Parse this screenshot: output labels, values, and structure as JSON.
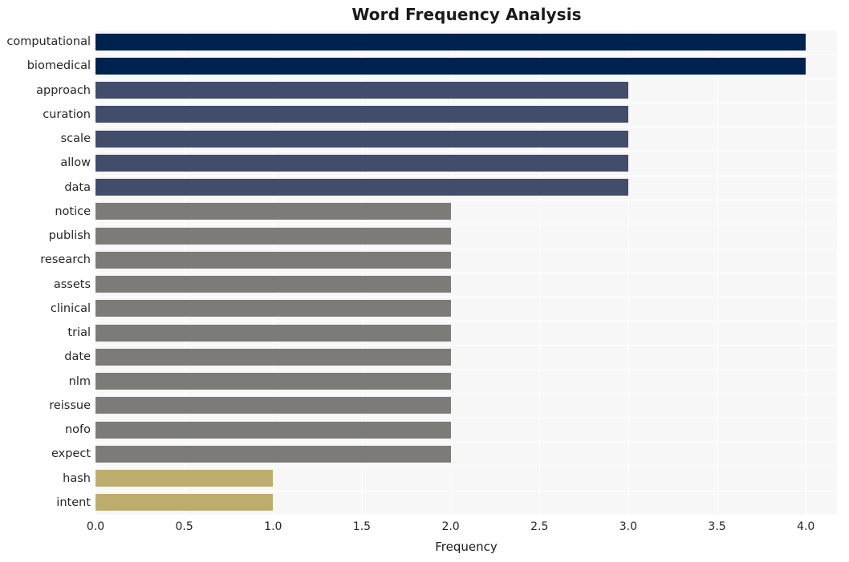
{
  "chart_data": {
    "type": "bar",
    "orientation": "horizontal",
    "title": "Word Frequency Analysis",
    "xlabel": "Frequency",
    "ylabel": "",
    "xlim": [
      0,
      4.0
    ],
    "xticks": [
      "0.0",
      "0.5",
      "1.0",
      "1.5",
      "2.0",
      "2.5",
      "3.0",
      "3.5",
      "4.0"
    ],
    "xtick_values": [
      0.0,
      0.5,
      1.0,
      1.5,
      2.0,
      2.5,
      3.0,
      3.5,
      4.0
    ],
    "grid": true,
    "legend": null,
    "plot_background": "#f7f7f7",
    "grid_color": "#ffffff",
    "categories": [
      "computational",
      "biomedical",
      "approach",
      "curation",
      "scale",
      "allow",
      "data",
      "notice",
      "publish",
      "research",
      "assets",
      "clinical",
      "trial",
      "date",
      "nlm",
      "reissue",
      "nofo",
      "expect",
      "hash",
      "intent"
    ],
    "values": [
      4,
      4,
      3,
      3,
      3,
      3,
      3,
      2,
      2,
      2,
      2,
      2,
      2,
      2,
      2,
      2,
      2,
      2,
      1,
      1
    ],
    "bar_colors": [
      "#00224e",
      "#00224e",
      "#414d6b",
      "#414d6b",
      "#414d6b",
      "#414d6b",
      "#414d6b",
      "#7c7b78",
      "#7c7b78",
      "#7c7b78",
      "#7c7b78",
      "#7c7b78",
      "#7c7b78",
      "#7c7b78",
      "#7c7b78",
      "#7c7b78",
      "#7c7b78",
      "#7c7b78",
      "#bdad6d",
      "#bdad6d"
    ],
    "palette_name": "cividis"
  }
}
